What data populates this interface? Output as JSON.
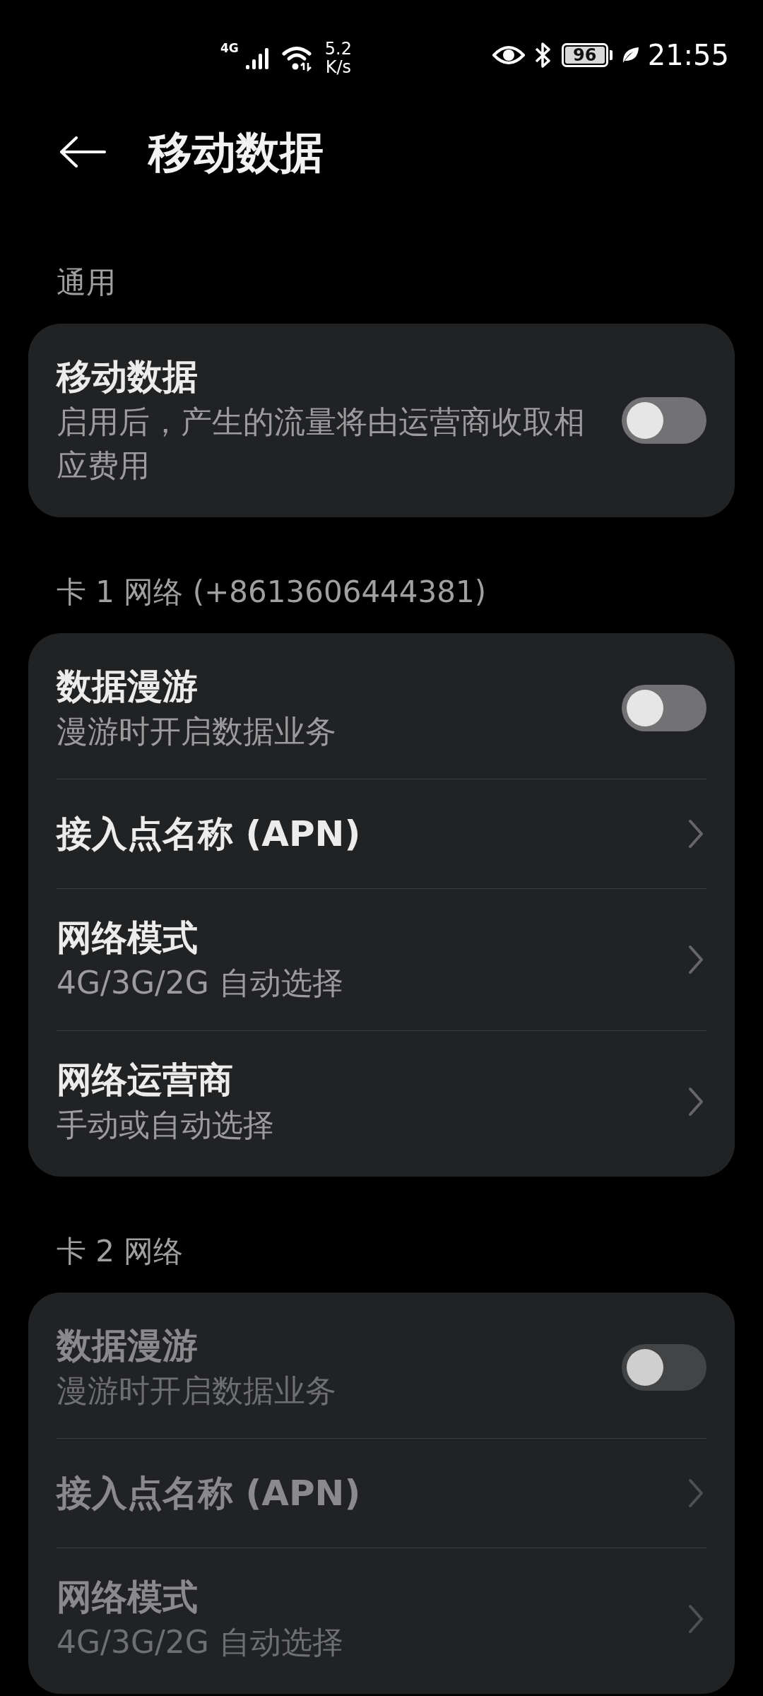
{
  "status_bar": {
    "network": "4G",
    "speed": "5.2",
    "speed_unit": "K/s",
    "battery": "96",
    "time": "21:55"
  },
  "header": {
    "title": "移动数据"
  },
  "sections": [
    {
      "title": "通用",
      "items": [
        {
          "kind": "toggle",
          "title": "移动数据",
          "subtitle": "启用后，产生的流量将由运营商收取相应费用",
          "on": false,
          "disabled": false
        }
      ]
    },
    {
      "title": "卡 1 网络 (+8613606444381)",
      "items": [
        {
          "kind": "toggle",
          "title": "数据漫游",
          "subtitle": "漫游时开启数据业务",
          "on": false,
          "disabled": false
        },
        {
          "kind": "link",
          "title": "接入点名称 (APN)",
          "disabled": false
        },
        {
          "kind": "link",
          "title": "网络模式",
          "subtitle": "4G/3G/2G 自动选择",
          "disabled": false
        },
        {
          "kind": "link",
          "title": "网络运营商",
          "subtitle": "手动或自动选择",
          "disabled": false
        }
      ]
    },
    {
      "title": "卡 2 网络",
      "items": [
        {
          "kind": "toggle",
          "title": "数据漫游",
          "subtitle": "漫游时开启数据业务",
          "on": false,
          "disabled": true
        },
        {
          "kind": "link",
          "title": "接入点名称 (APN)",
          "disabled": true
        },
        {
          "kind": "link",
          "title": "网络模式",
          "subtitle": "4G/3G/2G 自动选择",
          "disabled": true
        }
      ]
    }
  ]
}
